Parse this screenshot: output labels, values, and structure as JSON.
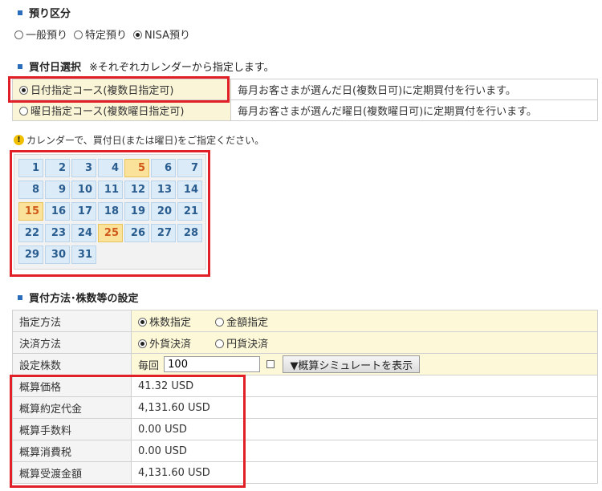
{
  "deposit": {
    "title": "預り区分",
    "options": [
      {
        "label": "一般預り",
        "selected": false
      },
      {
        "label": "特定預り",
        "selected": false
      },
      {
        "label": "NISA預り",
        "selected": true
      }
    ]
  },
  "purchase_date": {
    "title": "買付日選択",
    "note": "※それぞれカレンダーから指定します。",
    "courses": [
      {
        "label": "日付指定コース(複数日指定可)",
        "desc": "毎月お客さまが選んだ日(複数日可)に定期買付を行います。",
        "selected": true
      },
      {
        "label": "曜日指定コース(複数曜日指定可)",
        "desc": "毎月お客さまが選んだ曜日(複数曜日可)に定期買付を行います。",
        "selected": false
      }
    ],
    "notice": "カレンダーで、買付日(または曜日)をご指定ください。"
  },
  "calendar": {
    "days": [
      "1",
      "2",
      "3",
      "4",
      "5",
      "6",
      "7",
      "8",
      "9",
      "10",
      "11",
      "12",
      "13",
      "14",
      "15",
      "16",
      "17",
      "18",
      "19",
      "20",
      "21",
      "22",
      "23",
      "24",
      "25",
      "26",
      "27",
      "28",
      "29",
      "30",
      "31"
    ],
    "selected": [
      "5",
      "15",
      "25"
    ]
  },
  "method": {
    "title": "買付方法･株数等の設定",
    "spec_label": "指定方法",
    "spec_options": [
      {
        "label": "株数指定",
        "selected": true
      },
      {
        "label": "金額指定",
        "selected": false
      }
    ],
    "settle_label": "決済方法",
    "settle_options": [
      {
        "label": "外貨決済",
        "selected": true
      },
      {
        "label": "円貨決済",
        "selected": false
      }
    ],
    "shares_label": "設定株数",
    "every_label": "毎回",
    "shares_value": "100",
    "sim_button": "▼概算シミュレートを表示"
  },
  "estimates": [
    {
      "label": "概算価格",
      "value": "41.32 USD"
    },
    {
      "label": "概算約定代金",
      "value": "4,131.60 USD"
    },
    {
      "label": "概算手数料",
      "value": "0.00 USD"
    },
    {
      "label": "概算消費税",
      "value": "0.00 USD"
    },
    {
      "label": "概算受渡金額",
      "value": "4,131.60 USD"
    }
  ],
  "colors": {
    "highlight_red": "#e01f26",
    "calendar_cell": "#dcebf8",
    "calendar_selected": "#fbe29a",
    "section_marker": "#2a6ebb"
  }
}
